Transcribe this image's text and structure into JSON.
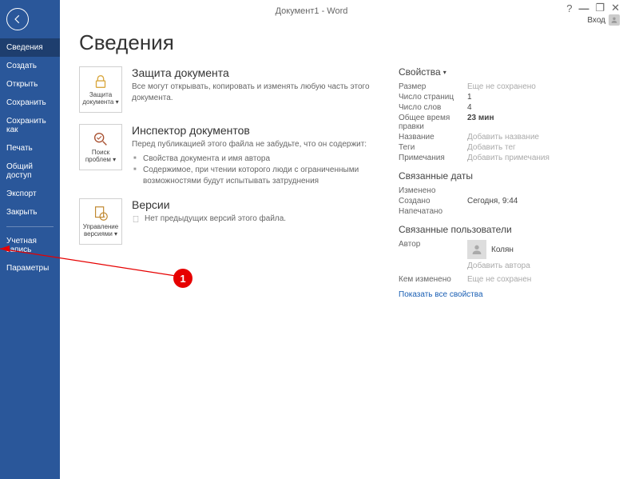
{
  "titlebar": {
    "title": "Документ1 - Word",
    "login": "Вход"
  },
  "sidebar": {
    "items": [
      "Сведения",
      "Создать",
      "Открыть",
      "Сохранить",
      "Сохранить как",
      "Печать",
      "Общий доступ",
      "Экспорт",
      "Закрыть"
    ],
    "footer_items": [
      "Учетная запись",
      "Параметры"
    ]
  },
  "page": {
    "title": "Сведения"
  },
  "sections": {
    "protect": {
      "btn": "Защита документа",
      "title": "Защита документа",
      "desc": "Все могут открывать, копировать и изменять любую часть этого документа."
    },
    "inspect": {
      "btn": "Поиск проблем",
      "title": "Инспектор документов",
      "desc": "Перед публикацией этого файла не забудьте, что он содержит:",
      "bullets": [
        "Свойства документа и имя автора",
        "Содержимое, при чтении которого люди с ограниченными возможностями будут испытывать затруднения"
      ]
    },
    "versions": {
      "btn": "Управление версиями",
      "title": "Версии",
      "desc": "Нет предыдущих версий этого файла."
    }
  },
  "props": {
    "heading": "Свойства",
    "rows": [
      {
        "label": "Размер",
        "value": "Еще не сохранено",
        "placeholder": true
      },
      {
        "label": "Число страниц",
        "value": "1"
      },
      {
        "label": "Число слов",
        "value": "4"
      },
      {
        "label": "Общее время правки",
        "value": "23 мин",
        "bold": true
      },
      {
        "label": "Название",
        "value": "Добавить название",
        "placeholder": true
      },
      {
        "label": "Теги",
        "value": "Добавить тег",
        "placeholder": true
      },
      {
        "label": "Примечания",
        "value": "Добавить примечания",
        "placeholder": true
      }
    ],
    "dates_heading": "Связанные даты",
    "date_rows": [
      {
        "label": "Изменено",
        "value": ""
      },
      {
        "label": "Создано",
        "value": "Сегодня, 9:44"
      },
      {
        "label": "Напечатано",
        "value": ""
      }
    ],
    "users_heading": "Связанные пользователи",
    "author_label": "Автор",
    "author_name": "Колян",
    "add_author": "Добавить автора",
    "modified_by_label": "Кем изменено",
    "modified_by_value": "Еще не сохранен",
    "show_all": "Показать все свойства"
  },
  "annotation": {
    "badge": "1"
  }
}
